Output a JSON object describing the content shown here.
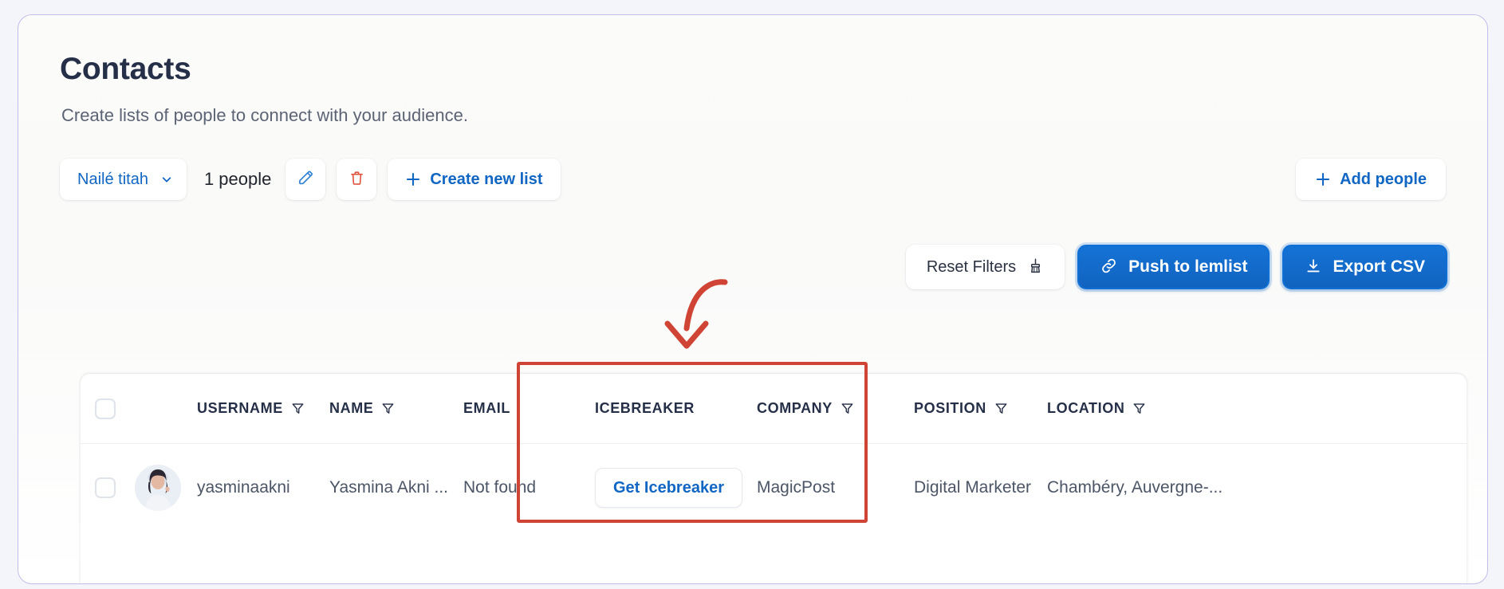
{
  "header": {
    "title": "Contacts",
    "subtitle": "Create lists of people to connect with your audience."
  },
  "toolbar": {
    "list_name": "Nailé titah",
    "chevron_icon": "chevron-down-icon",
    "people_count": "1 people",
    "edit_icon": "pencil-icon",
    "delete_icon": "trash-icon",
    "create_list_label": "Create new list",
    "create_list_icon": "plus-icon",
    "add_people_label": "Add people",
    "add_people_icon": "plus-icon"
  },
  "actions": {
    "reset_filters_label": "Reset Filters",
    "reset_filters_icon": "broom-icon",
    "push_label": "Push to lemlist",
    "push_icon": "link-icon",
    "export_label": "Export CSV",
    "export_icon": "download-icon"
  },
  "table": {
    "columns": [
      {
        "label": "USERNAME",
        "filter": true
      },
      {
        "label": "NAME",
        "filter": true
      },
      {
        "label": "EMAIL",
        "filter": false
      },
      {
        "label": "ICEBREAKER",
        "filter": false
      },
      {
        "label": "COMPANY",
        "filter": true
      },
      {
        "label": "POSITION",
        "filter": true
      },
      {
        "label": "LOCATION",
        "filter": true
      }
    ],
    "rows": [
      {
        "username": "yasminaakni",
        "name": "Yasmina Akni ...",
        "email": "Not found",
        "icebreaker_label": "Get Icebreaker",
        "company": "MagicPost",
        "position": "Digital Marketer",
        "location": "Chambéry, Auvergne-..."
      }
    ]
  },
  "annotations": {
    "highlight_color": "#cf4434",
    "arrow_icon": "curved-arrow-down-icon",
    "highlight_target": "email-and-icebreaker-columns"
  },
  "colors": {
    "accent_blue": "#1166c4",
    "button_blue": "#1473d6",
    "danger_red": "#e0503a",
    "card_border": "#c3bdea",
    "text_dark": "#252f48"
  }
}
